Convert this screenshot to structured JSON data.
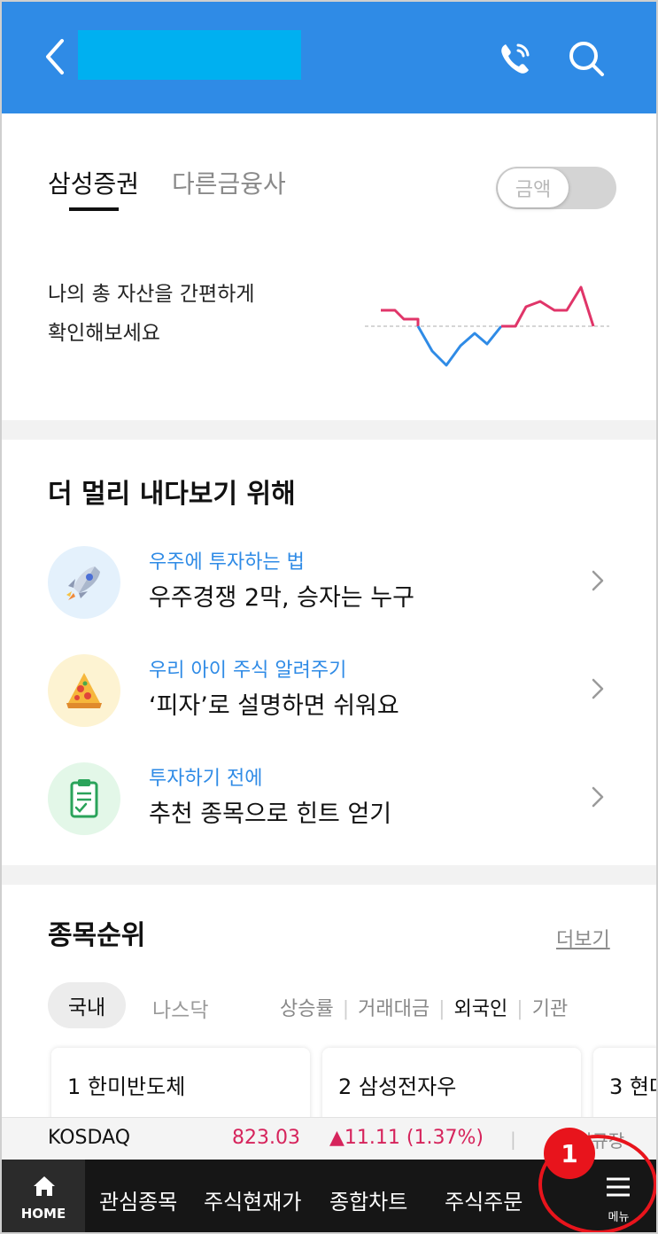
{
  "header": {
    "back_icon": "chevron-left-icon",
    "phone_icon": "phone-icon",
    "search_icon": "search-icon",
    "background": "#2f8be6"
  },
  "asset": {
    "tabs": [
      {
        "label": "삼성증권",
        "active": true
      },
      {
        "label": "다른금융사",
        "active": false
      }
    ],
    "toggle_label": "금액",
    "desc_line1": "나의 총 자산을 간편하게",
    "desc_line2": "확인해보세요"
  },
  "content": {
    "title": "더 멀리 내다보기 위해",
    "items": [
      {
        "sub": "우주에 투자하는 법",
        "main": "우주경쟁 2막, 승자는 누구",
        "icon": "rocket-icon"
      },
      {
        "sub": "우리 아이 주식 알려주기",
        "main": "‘피자’로 설명하면 쉬워요",
        "icon": "pizza-icon"
      },
      {
        "sub": "투자하기 전에",
        "main": "추천 종목으로 힌트 얻기",
        "icon": "clipboard-icon"
      }
    ]
  },
  "ranking": {
    "title": "종목순위",
    "more": "더보기",
    "market_tabs": [
      "국내",
      "나스닥"
    ],
    "filters": [
      "상승률",
      "거래대금",
      "외국인",
      "기관"
    ],
    "selected_filter": "외국인",
    "cards": [
      "1 한미반도체",
      "2 삼성전자우",
      "3 현대"
    ]
  },
  "ticker": {
    "name": "KOSDAQ",
    "price": "823.03",
    "change": "▲11.11 (1.37%)",
    "separator": "|",
    "status": "정규장"
  },
  "bottom_nav": {
    "home": "HOME",
    "items": [
      "관심종목",
      "주식현재가",
      "종합차트",
      "주식주문"
    ],
    "menu": "메뉴"
  },
  "annotation": {
    "badge": "1",
    "color": "#e8141c"
  }
}
